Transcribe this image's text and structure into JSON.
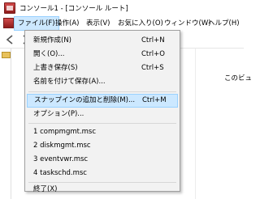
{
  "window": {
    "title": "コンソール1 - [コンソール ルート]"
  },
  "menubar": {
    "items": [
      {
        "label": "ファイル(F)"
      },
      {
        "label": "操作(A)"
      },
      {
        "label": "表示(V)"
      },
      {
        "label": "お気に入り(O)"
      },
      {
        "label": "ウィンドウ(W)"
      },
      {
        "label": "ヘルプ(H)"
      }
    ]
  },
  "file_menu": {
    "new": {
      "label": "新規作成(N)",
      "shortcut": "Ctrl+N"
    },
    "open": {
      "label": "開く(O)...",
      "shortcut": "Ctrl+O"
    },
    "save": {
      "label": "上書き保存(S)",
      "shortcut": "Ctrl+S"
    },
    "save_as": {
      "label": "名前を付けて保存(A)..."
    },
    "snapin": {
      "label": "スナップインの追加と削除(M)...",
      "shortcut": "Ctrl+M"
    },
    "options": {
      "label": "オプション(P)..."
    },
    "recent": [
      {
        "label": "1 compmgmt.msc"
      },
      {
        "label": "2 diskmgmt.msc"
      },
      {
        "label": "3 eventvwr.msc"
      },
      {
        "label": "4 taskschd.msc"
      }
    ],
    "exit": {
      "label": "終了(X)"
    }
  },
  "right_pane": {
    "text": "このビュ"
  },
  "colors": {
    "highlight": "#cce8ff",
    "highlight_border": "#99d1ff",
    "menu_bg": "#f2f2f2"
  },
  "icons": {
    "app": "mmc-console-icon",
    "back": "back-arrow-icon",
    "forward": "forward-arrow-icon",
    "folder": "folder-icon"
  }
}
